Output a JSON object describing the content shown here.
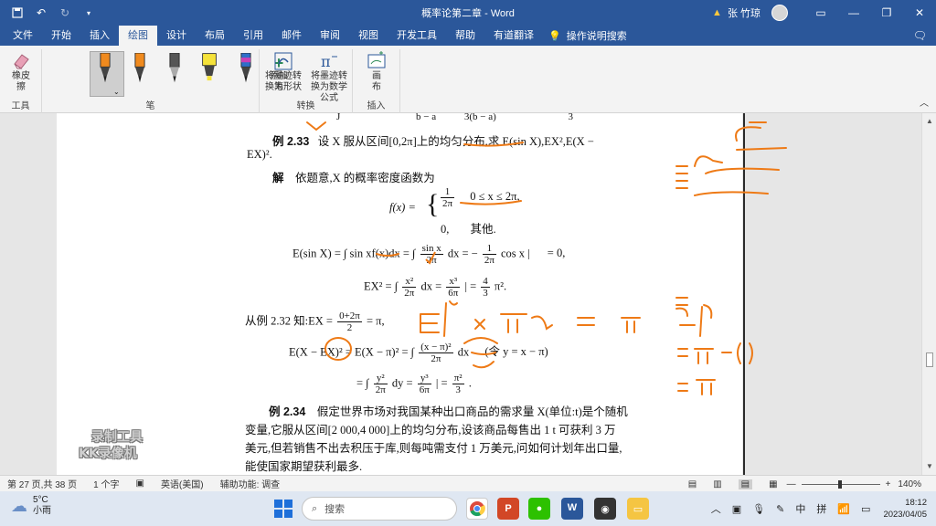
{
  "titlebar": {
    "title": "概率论第二章 - Word",
    "warning_icon": "warning-icon",
    "user_name": "张 竹琼"
  },
  "tabs": [
    "文件",
    "开始",
    "插入",
    "绘图",
    "设计",
    "布局",
    "引用",
    "邮件",
    "审阅",
    "视图",
    "开发工具",
    "帮助",
    "有道翻译"
  ],
  "active_tab": "绘图",
  "tell_me": "操作说明搜索",
  "ribbon": {
    "eraser_label": "橡皮擦",
    "tools_group": "工具",
    "pens_group": "笔",
    "add_pen_label": "添加笔",
    "convert_shape_label": "将墨迹转换为形状",
    "convert_math_label": "将墨迹转换为数学公式",
    "convert_group": "转换",
    "draw_canvas_label": "画布",
    "insert_group": "插入",
    "pen_colors": [
      "#f08a1e",
      "#f08a1e",
      "#333333",
      "#f5e23a",
      "#2f6fc9"
    ]
  },
  "document": {
    "frag_top_left": "J",
    "frag_top_mid": "b − a",
    "frag_top_mid2": "3(b − a)",
    "frag_top_right": "3",
    "ex233_label": "例 2.33",
    "ex233_text": "设 X 服从区间[0,2π]上的均匀分布,求 E(sin X),EX²,E(X −",
    "ex233_text2": "EX)².",
    "sol_label": "解",
    "sol_text": "依题意,X 的概率密度函数为",
    "fx_label": "f(x) =",
    "fx_case1_num": "1",
    "fx_case1_den": "2π",
    "fx_case1_cond": "0 ≤ x ≤ 2π,",
    "fx_case2_val": "0,",
    "fx_case2_cond": "其他.",
    "esin_lhs": "E(sin X) =",
    "esin_int1": "∫ sin xf(x)dx = ∫",
    "esin_frac_num": "sin x",
    "esin_frac_den": "2π",
    "esin_mid": "dx = −",
    "esin_frac2_num": "1",
    "esin_frac2_den": "2π",
    "esin_tail": "cos x |",
    "esin_result": "= 0,",
    "ex2_lhs": "EX² = ∫",
    "ex2_frac_num": "x²",
    "ex2_frac_den": "2π",
    "ex2_mid": "dx =",
    "ex2_frac2_num": "x³",
    "ex2_frac2_den": "6π",
    "ex2_eq": "| =",
    "ex2_res_num": "4",
    "ex2_res_den": "3",
    "ex2_res_tail": "π².",
    "from_ex": "从例 2.32 知:EX =",
    "from_frac_num": "0+2π",
    "from_frac_den": "2",
    "from_tail": "= π,",
    "var_lhs": "E(X − EX)² = E(X − π)² = ∫",
    "var_frac_num": "(x − π)²",
    "var_frac_den": "2π",
    "var_mid": "dx",
    "var_sub": "(令 y = x − π)",
    "var2_lhs": "= ∫",
    "var2_frac_num": "y²",
    "var2_frac_den": "2π",
    "var2_mid": "dy =",
    "var2_frac2_num": "y³",
    "var2_frac2_den": "6π",
    "var2_eq": "| =",
    "var2_res_num": "π²",
    "var2_res_den": "3",
    "var2_tail": ".",
    "ex234_label": "例 2.34",
    "ex234_line1": "假定世界市场对我国某种出口商品的需求量 X(单位:t)是个随机",
    "ex234_line2": "变量,它服从区间[2 000,4 000]上的均匀分布,设该商品每售出 1 t 可获利 3 万",
    "ex234_line3": "美元,但若销售不出去积压于库,则每吨需支付 1 万美元,问如何计划年出口量,",
    "ex234_line4": "能使国家期望获利最多."
  },
  "watermark": {
    "line1": "录制工具",
    "line2": "KK录像机"
  },
  "statusbar": {
    "page": "第 27 页,共 38 页",
    "words": "1 个字",
    "lang": "英语(美国)",
    "accessibility": "辅助功能: 调查",
    "zoom": "140%"
  },
  "taskbar": {
    "temp": "5°C",
    "weather": "小雨",
    "search_placeholder": "搜索",
    "ime1": "中",
    "ime2": "拼",
    "time": "18:12",
    "date": "2023/04/05"
  }
}
